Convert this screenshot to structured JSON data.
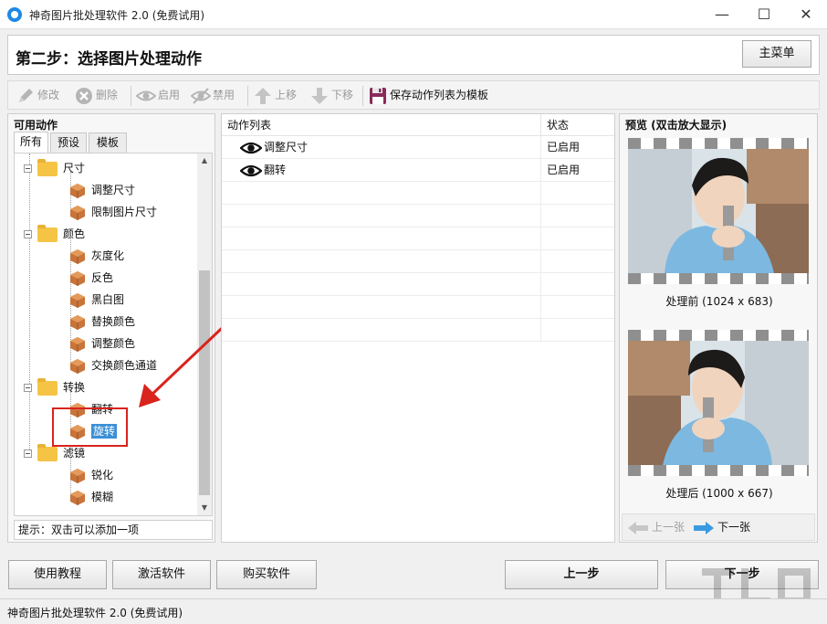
{
  "window": {
    "title": "神奇图片批处理软件 2.0 (免费试用)",
    "min": "—",
    "max": "☐",
    "close": "✕"
  },
  "step": {
    "title": "第二步：选择图片处理动作",
    "main_menu": "主菜单"
  },
  "toolbar": {
    "edit": "修改",
    "delete": "删除",
    "enable": "启用",
    "disable": "禁用",
    "move_up": "上移",
    "move_down": "下移",
    "save_template": "保存动作列表为模板"
  },
  "left_panel": {
    "title": "可用动作",
    "tabs": [
      "所有",
      "预设",
      "模板"
    ],
    "tree": {
      "size": "尺寸",
      "resize": "调整尺寸",
      "limit_size": "限制图片尺寸",
      "color": "颜色",
      "grayscale": "灰度化",
      "invert": "反色",
      "black_white": "黑白图",
      "replace_color": "替换颜色",
      "adjust_color": "调整颜色",
      "swap_channels": "交换颜色通道",
      "transform": "转换",
      "flip": "翻转",
      "rotate": "旋转",
      "filter": "滤镜",
      "sharpen": "锐化",
      "blur": "模糊"
    },
    "hint": "提示：双击可以添加一项"
  },
  "action_list": {
    "col_name": "动作列表",
    "col_status": "状态",
    "rows": [
      {
        "name": "调整尺寸",
        "status": "已启用"
      },
      {
        "name": "翻转",
        "status": "已启用"
      }
    ]
  },
  "preview": {
    "title": "预览 (双击放大显示)",
    "before": "处理前 (1024 x 683)",
    "after": "处理后 (1000 x 667)",
    "prev": "上一张",
    "next": "下一张"
  },
  "buttons": {
    "tutorial": "使用教程",
    "activate": "激活软件",
    "buy": "购买软件",
    "prev_step": "上一步",
    "next_step": "下一步"
  },
  "statusbar": {
    "text": "神奇图片批处理软件 2.0 (免费试用)"
  },
  "colors": {
    "highlight": "#d9231d",
    "selection": "#3b8fd6",
    "folder": "#f6c445",
    "box": "#c8743a",
    "nav_arrow": "#3a9be0"
  }
}
